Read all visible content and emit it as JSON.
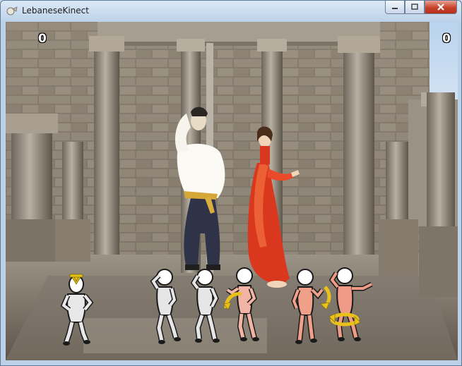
{
  "window": {
    "title": "LebaneseKinect",
    "controls": [
      {
        "name": "minimize-button",
        "icon": "minimize-icon"
      },
      {
        "name": "maximize-button",
        "icon": "maximize-icon"
      },
      {
        "name": "close-button",
        "icon": "close-icon"
      }
    ]
  },
  "game": {
    "score_left": "0",
    "score_right": "0",
    "scene": "ancient-stone-ruins-background",
    "dancers": [
      {
        "name": "male-dancer",
        "outfit": "white shirt, dark baggy trousers, gold sash"
      },
      {
        "name": "female-dancer",
        "outfit": "red dress"
      }
    ],
    "pose_cards": [
      {
        "name": "pose-card-1",
        "tint": "#e8e8e8",
        "arrow": "down"
      },
      {
        "name": "pose-card-2",
        "tint": "#e6e6e6",
        "arrow": "none"
      },
      {
        "name": "pose-card-3",
        "tint": "#e6e6e6",
        "arrow": "none"
      },
      {
        "name": "pose-card-4",
        "tint": "#f2b4a4",
        "arrow": "curve-left"
      },
      {
        "name": "pose-card-5",
        "tint": "#f0a088",
        "arrow": "curve-right"
      },
      {
        "name": "pose-card-6",
        "tint": "#ef9b88",
        "arrow": "spin"
      }
    ]
  },
  "colors": {
    "arrow": "#e8c21a",
    "score_text": "#ffffff",
    "close_button": "#c7412a"
  }
}
